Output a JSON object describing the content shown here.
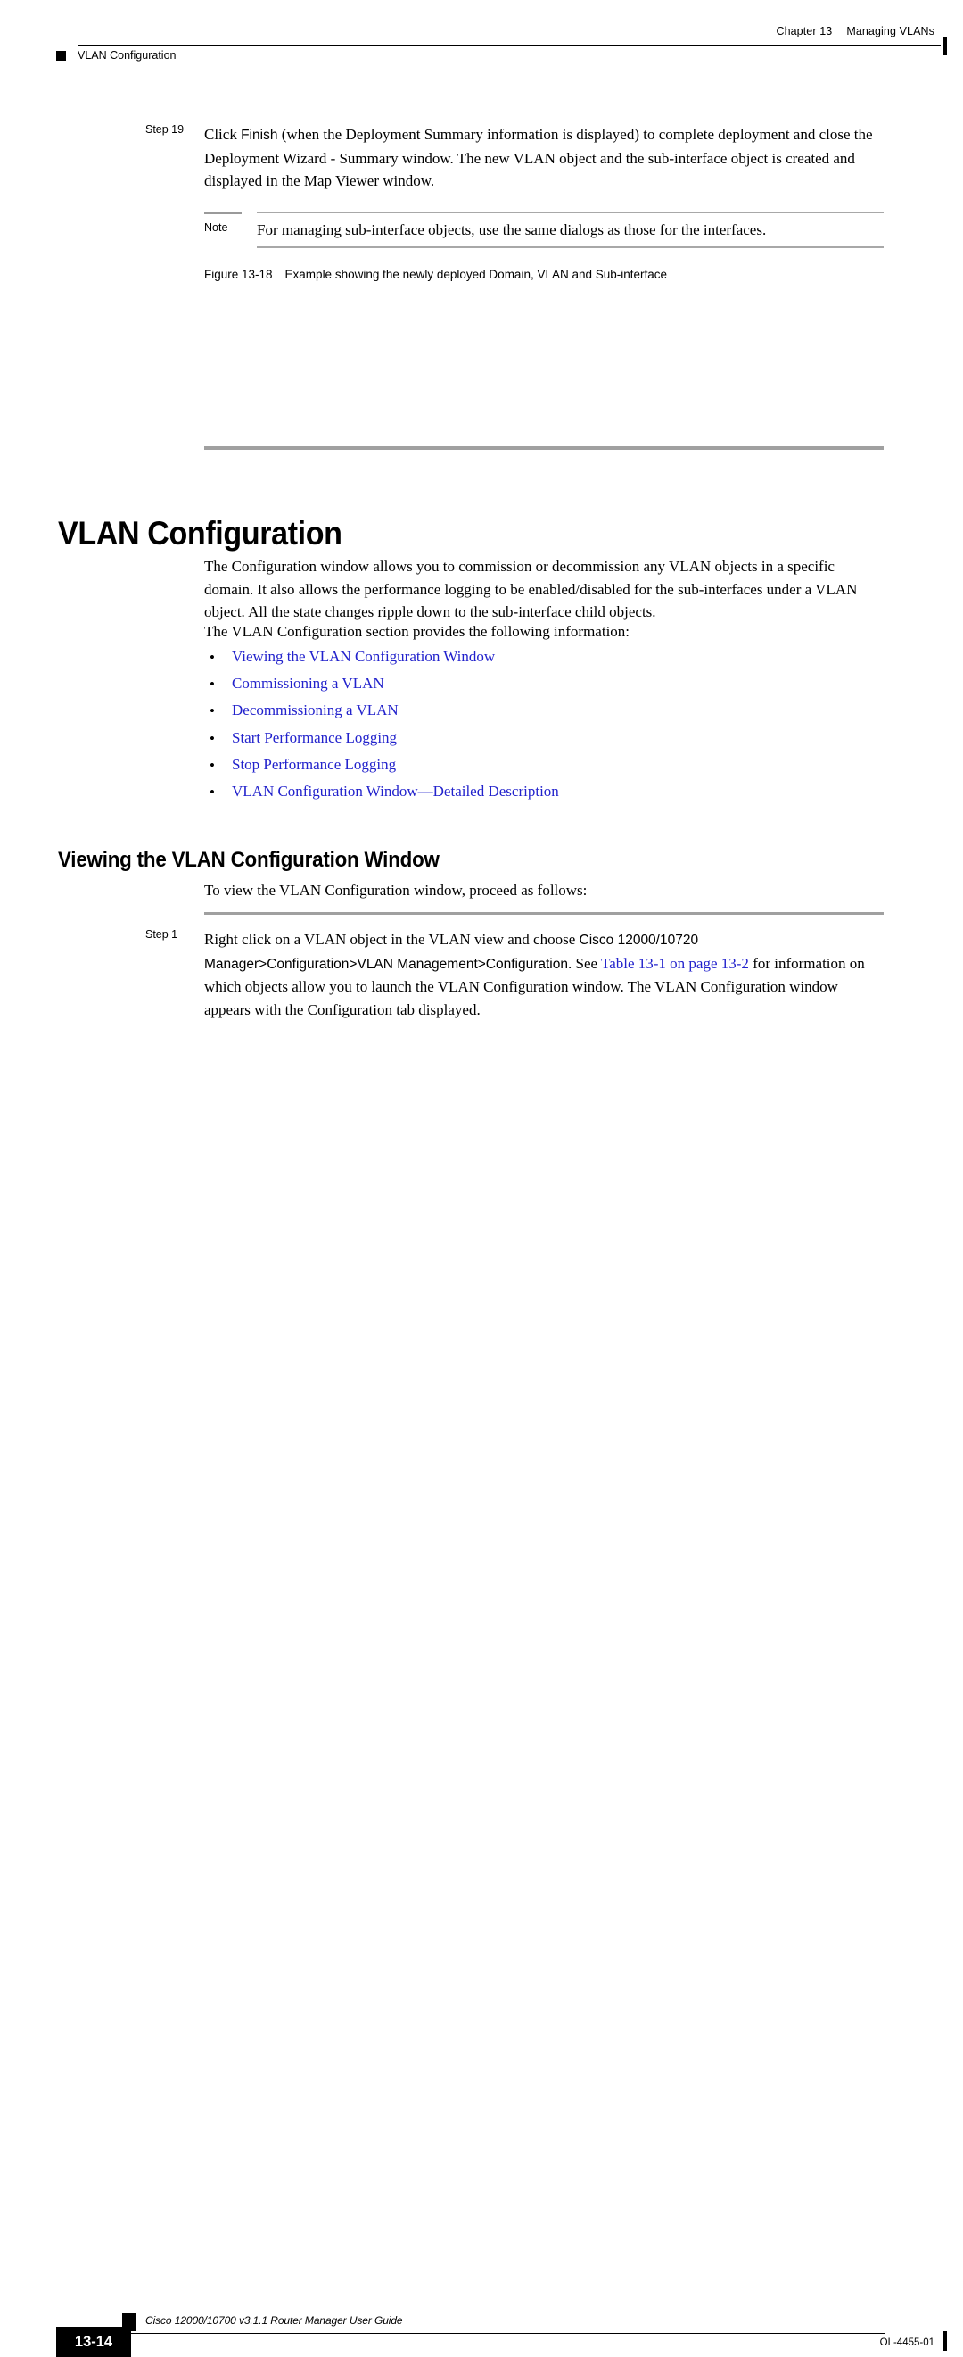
{
  "header": {
    "chapter_number": "Chapter 13",
    "chapter_title": "Managing VLANs",
    "section_label": "VLAN Configuration"
  },
  "step19": {
    "label": "Step 19",
    "text_part1": "Click ",
    "ui_text": "Finish",
    "text_part2": " (when the Deployment Summary information is displayed) to complete deployment and close the Deployment Wizard - Summary window. The new VLAN object and the sub-interface object is created and displayed in the Map Viewer window."
  },
  "note": {
    "label": "Note",
    "text": "For managing sub-interface objects, use the same dialogs as those for the interfaces."
  },
  "figure": {
    "number": "Figure 13-18",
    "caption": "Example showing the newly deployed Domain, VLAN and Sub-interface"
  },
  "heading": {
    "h1": "VLAN Configuration",
    "h2": "Viewing the VLAN Configuration Window"
  },
  "paragraphs": {
    "intro": "The Configuration window allows you to commission or decommission any VLAN objects in a specific domain. It also allows the performance logging to be enabled/disabled for the sub-interfaces under a VLAN object. All the state changes ripple down to the sub-interface child objects.",
    "provides": "The VLAN Configuration section provides the following information:",
    "to_view": "To view the VLAN Configuration window, proceed as follows:"
  },
  "bullet_list": {
    "marker": "•",
    "items": [
      "Viewing the VLAN Configuration Window",
      "Commissioning a VLAN",
      "Decommissioning a VLAN",
      "Start Performance Logging",
      "Stop Performance Logging",
      "VLAN Configuration Window—Detailed Description"
    ]
  },
  "step1": {
    "label": "Step 1",
    "text_part1": "Right click on a VLAN object in the VLAN view and choose ",
    "ui_text": "Cisco 12000/10720 Manager>Configuration>VLAN Management>Configuration",
    "text_part2": ". See ",
    "link_text": "Table 13-1 on page 13-2",
    "text_part3": " for information on which objects allow you to launch the VLAN Configuration window. The VLAN Configuration window appears with the Configuration tab displayed."
  },
  "footer": {
    "page_number": "13-14",
    "guide_title": "Cisco 12000/10700 v3.1.1 Router Manager User Guide",
    "doc_id": "OL-4455-01"
  },
  "colors": {
    "link_blue": "#2222cc",
    "rule_gray": "#a0a0a0",
    "text_black": "#000000"
  }
}
